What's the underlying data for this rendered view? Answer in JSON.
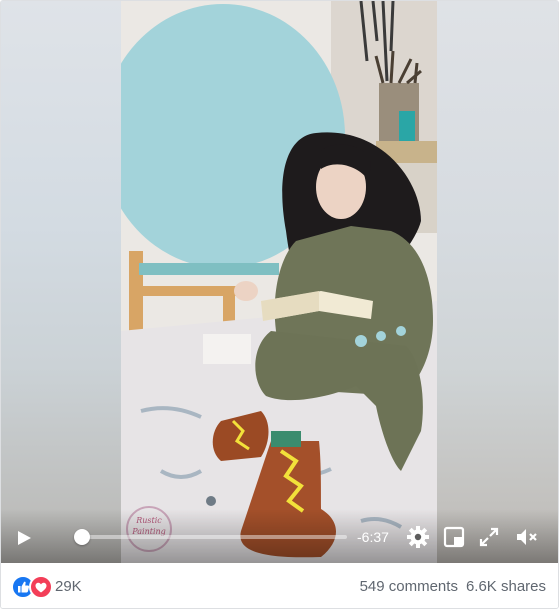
{
  "player": {
    "time_remaining": "-6:37",
    "progress_fraction": 0.02,
    "watermark": "Rustic Painting"
  },
  "footer": {
    "reaction_count": "29K",
    "comments": "549 comments",
    "shares": "6.6K shares"
  },
  "icons": {
    "play": "play-icon",
    "settings": "gear-icon",
    "pip": "picture-in-picture-icon",
    "fullscreen": "fullscreen-icon",
    "mute": "volume-muted-icon",
    "like": "like-icon",
    "love": "love-icon"
  },
  "colors": {
    "like": "#1877f2",
    "love": "#f33e58",
    "muted_text": "#606770"
  }
}
